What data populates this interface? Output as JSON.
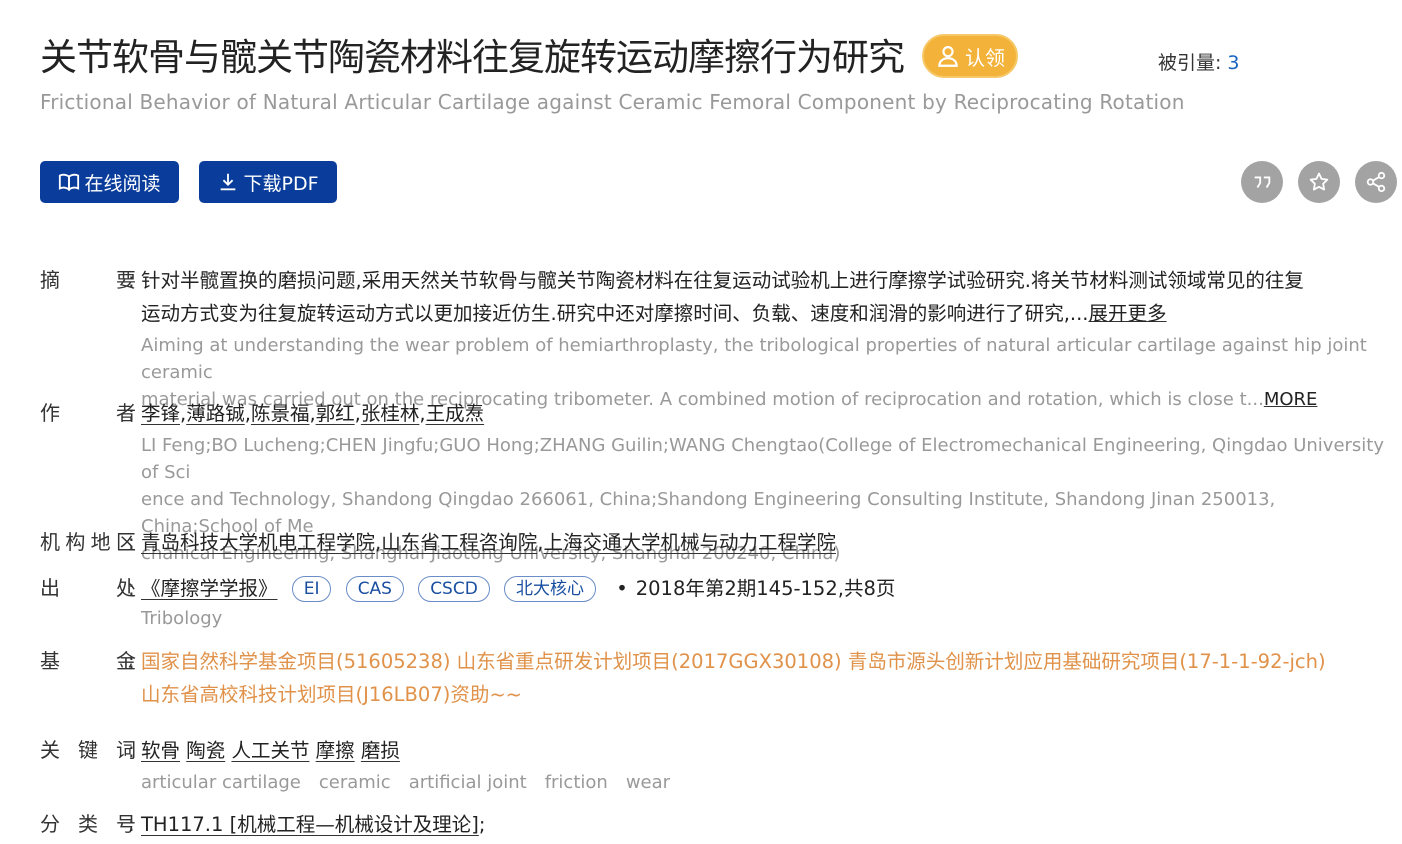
{
  "article": {
    "title_cn": "关节软骨与髋关节陶瓷材料往复旋转运动摩擦行为研究",
    "title_en": "Frictional Behavior of Natural Articular Cartilage against Ceramic Femoral Component by Reciprocating Rotation",
    "claim_label": "认领",
    "cited_label": "被引量:",
    "cited_count": "3"
  },
  "actions": {
    "read_online": "在线阅读",
    "download_pdf": "下载PDF"
  },
  "icons": {
    "claim": "user-icon",
    "read": "book-icon",
    "download": "download-icon",
    "cite": "quote-icon",
    "favorite": "star-icon",
    "share": "share-icon"
  },
  "colors": {
    "primary": "#0a3d9b",
    "claim": "#f3b33a",
    "fund": "#e0924a",
    "muted": "#999999"
  },
  "abstract": {
    "label": "摘 要",
    "cn_line1": "针对半髋置换的磨损问题,采用天然关节软骨与髋关节陶瓷材料在往复运动试验机上进行摩擦学试验研究.将关节材料测试领域常见的往复",
    "cn_line2": "运动方式变为往复旋转运动方式以更加接近仿生.研究中还对摩擦时间、负载、速度和润滑的影响进行了研究,...",
    "cn_more": "展开更多",
    "en_line1": "Aiming at understanding the wear problem of hemiarthroplasty, the tribological properties of natural articular cartilage against hip joint ceramic",
    "en_line2": "material was carried out on the reciprocating tribometer. A combined motion of reciprocation and rotation, which is close t...",
    "en_more": "MORE"
  },
  "authors": {
    "label": "作 者",
    "names": [
      "李锋",
      "薄路铖",
      "陈景福",
      "郭红",
      "张桂林",
      "王成焘"
    ],
    "en_line1": "LI Feng;BO Lucheng;CHEN Jingfu;GUO Hong;ZHANG Guilin;WANG Chengtao(College of Electromechanical Engineering, Qingdao University of Sci",
    "en_line2": "ence and Technology, Shandong Qingdao 266061, China;Shandong Engineering Consulting Institute, Shandong Jinan 250013, China;School of Me",
    "en_line3": "chanical Engineering, Shanghai Jiaotong University, Shanghai 200240, China)"
  },
  "institutions": {
    "label": "机构地区",
    "items": [
      "青岛科技大学机电工程学院",
      "山东省工程咨询院",
      "上海交通大学机械与动力工程学院"
    ]
  },
  "source": {
    "label": "出 处",
    "journal": "《摩擦学学报》",
    "tags": [
      "EI",
      "CAS",
      "CSCD",
      "北大核心"
    ],
    "issue": "2018年第2期145-152,共8页",
    "journal_en": "Tribology"
  },
  "funding": {
    "label": "基 金",
    "line1": "国家自然科学基金项目(51605238) 山东省重点研发计划项目(2017GGX30108) 青岛市源头创新计划应用基础研究项目(17-1-1-92-jch)",
    "line2": "山东省高校科技计划项目(J16LB07)资助~~"
  },
  "keywords": {
    "label": "关 键 词",
    "cn": [
      "软骨",
      "陶瓷",
      "人工关节",
      "摩擦",
      "磨损"
    ],
    "en": [
      "articular cartilage",
      "ceramic",
      "artificial joint",
      "friction",
      "wear"
    ]
  },
  "classification": {
    "label": "分 类 号",
    "code": "TH117.1 [机械工程—机械设计及理论]",
    "suffix": ";"
  },
  "punct": {
    "colon": ":",
    "comma": ",",
    "bullet": "•"
  }
}
